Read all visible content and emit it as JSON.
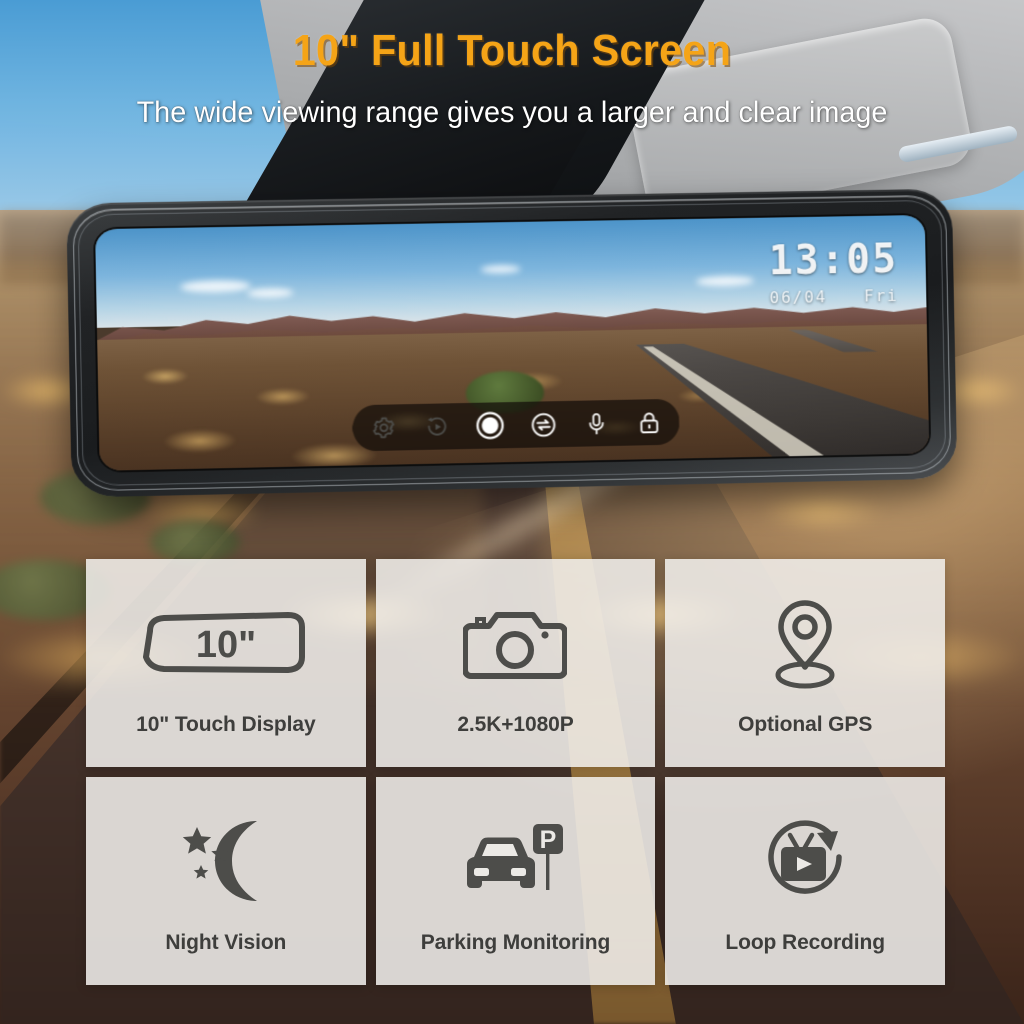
{
  "header": {
    "headline": "10\" Full Touch Screen",
    "headline_color": "#F5A417",
    "subline": "The wide viewing range gives you a larger and clear image",
    "subline_color": "#FFFFFF"
  },
  "device": {
    "name": "rearview-mirror-dash-cam",
    "screen": {
      "clock": {
        "time": "13:05",
        "date": "06/04",
        "weekday": "Fri"
      },
      "toolbar": {
        "buttons": [
          {
            "name": "settings-icon",
            "label": "Settings"
          },
          {
            "name": "playback-icon",
            "label": "Playback"
          },
          {
            "name": "record-icon",
            "label": "Record"
          },
          {
            "name": "switch-camera-icon",
            "label": "Switch Camera"
          },
          {
            "name": "microphone-icon",
            "label": "Microphone"
          },
          {
            "name": "lock-icon",
            "label": "Lock"
          }
        ]
      }
    }
  },
  "features": [
    {
      "icon": "mirror-size-icon",
      "badge": "10\"",
      "label": "10\" Touch Display"
    },
    {
      "icon": "camera-icon",
      "badge": "",
      "label": "2.5K+1080P"
    },
    {
      "icon": "gps-pin-icon",
      "badge": "",
      "label": "Optional GPS"
    },
    {
      "icon": "moon-stars-icon",
      "badge": "",
      "label": "Night Vision"
    },
    {
      "icon": "car-parking-icon",
      "badge": "",
      "label": "Parking Monitoring"
    },
    {
      "icon": "loop-record-icon",
      "badge": "",
      "label": "Loop Recording"
    }
  ],
  "colors": {
    "accent": "#F5A417",
    "card_bg": "#F0EEEA",
    "icon": "#4D4D4A",
    "bezel": "#212325"
  }
}
